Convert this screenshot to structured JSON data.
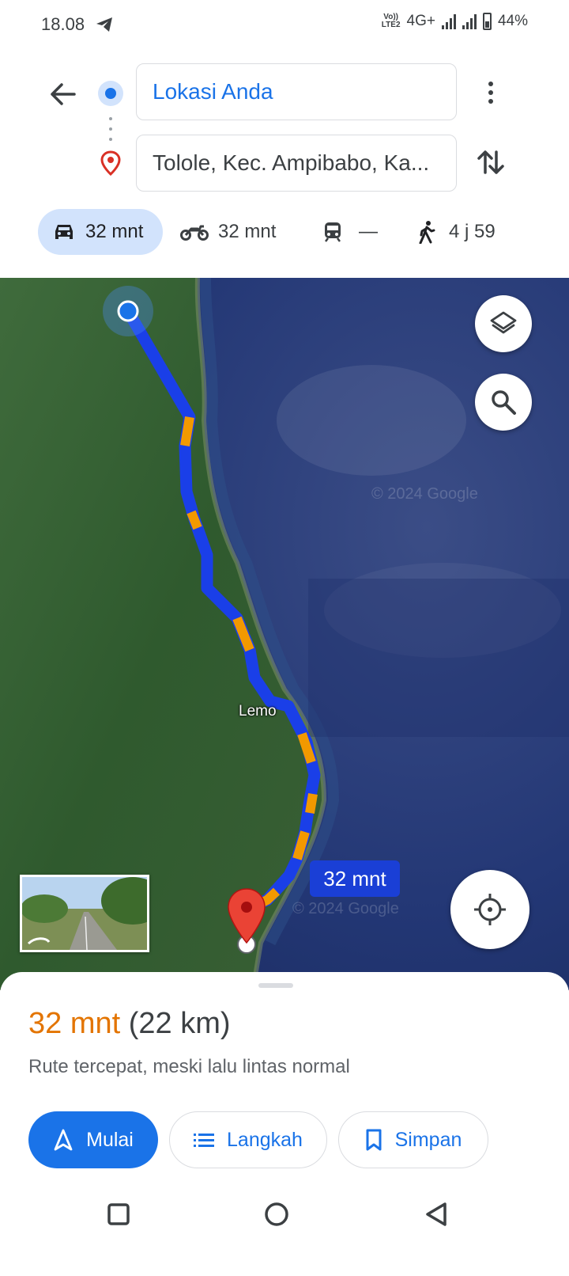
{
  "status": {
    "time": "18.08",
    "network": "4G+",
    "volte_top": "Vo))",
    "volte_bottom": "LTE2",
    "battery": "44%",
    "battery_level": 0.44
  },
  "route_inputs": {
    "origin": "Lokasi Anda",
    "destination": "Tolole, Kec. Ampibabo, Ka..."
  },
  "modes": [
    {
      "name": "car",
      "label": "32 mnt",
      "selected": true
    },
    {
      "name": "motorcycle",
      "label": "32 mnt",
      "selected": false
    },
    {
      "name": "transit",
      "label": "—",
      "selected": false
    },
    {
      "name": "walk",
      "label": "4 j 59",
      "selected": false
    }
  ],
  "map": {
    "place_label": "Lemo",
    "watermark": "© 2024 Google",
    "time_label": "32 mnt",
    "route_color": "#1a3fe8",
    "traffic_color": "#f29900"
  },
  "sheet": {
    "duration": "32 mnt",
    "distance": "(22 km)",
    "description": "Rute tercepat, meski lalu lintas normal",
    "buttons": {
      "start": "Mulai",
      "steps": "Langkah",
      "save": "Simpan"
    }
  },
  "colors": {
    "accent": "#1a73e8",
    "duration": "#e37400"
  }
}
